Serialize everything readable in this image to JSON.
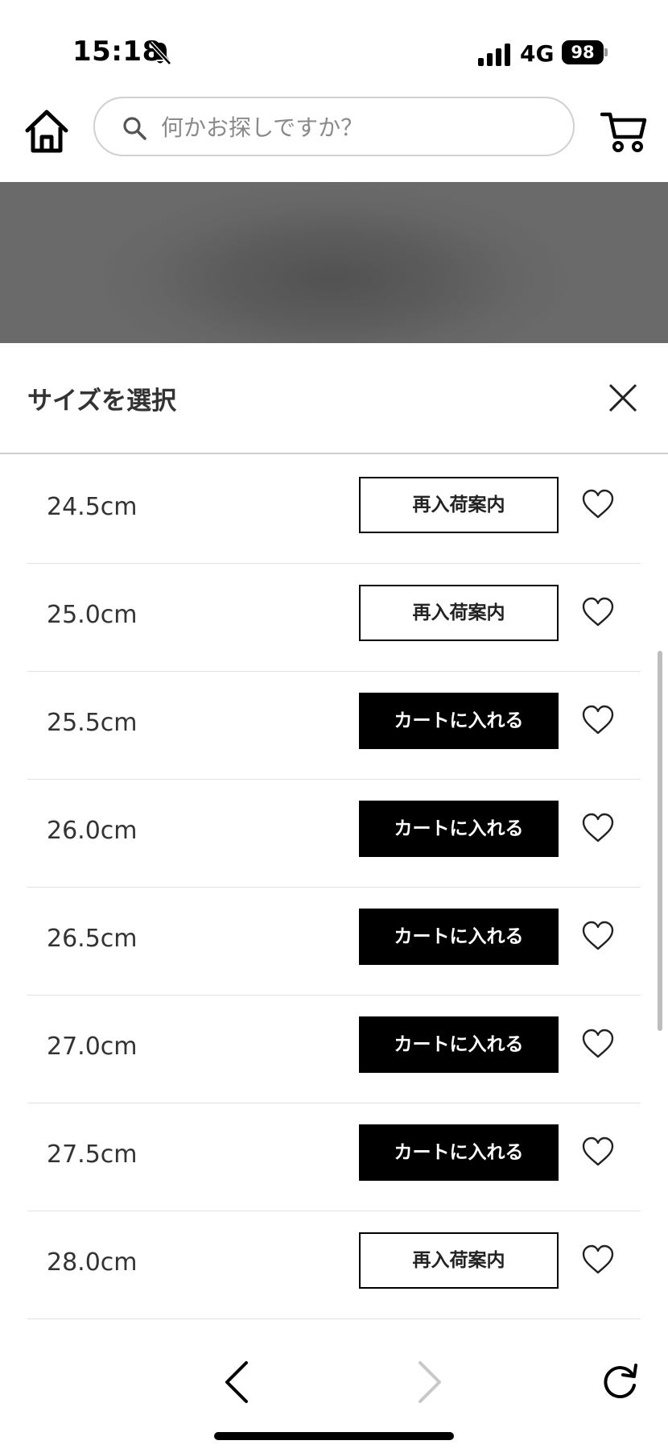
{
  "status_bar": {
    "time": "15:18",
    "network": "4G",
    "battery": "98"
  },
  "header": {
    "search_placeholder": "何かお探しですか？"
  },
  "sheet": {
    "title": "サイズを選択"
  },
  "sizes": [
    {
      "label": "24.5cm",
      "action": "再入荷案内",
      "style": "outline"
    },
    {
      "label": "25.0cm",
      "action": "再入荷案内",
      "style": "outline"
    },
    {
      "label": "25.5cm",
      "action": "カートに入れる",
      "style": "solid"
    },
    {
      "label": "26.0cm",
      "action": "カートに入れる",
      "style": "solid"
    },
    {
      "label": "26.5cm",
      "action": "カートに入れる",
      "style": "solid"
    },
    {
      "label": "27.0cm",
      "action": "カートに入れる",
      "style": "solid"
    },
    {
      "label": "27.5cm",
      "action": "カートに入れる",
      "style": "solid"
    },
    {
      "label": "28.0cm",
      "action": "再入荷案内",
      "style": "outline"
    }
  ],
  "icons": {
    "home": "home-icon",
    "search": "search-icon",
    "cart": "cart-icon",
    "close": "close-icon",
    "favorite": "heart-icon",
    "back": "chevron-left-icon",
    "forward": "chevron-right-icon",
    "reload": "reload-icon",
    "bell": "bell-slash-icon"
  },
  "colors": {
    "primary_button": "#000000",
    "forward_disabled": "#c8c8c8"
  }
}
